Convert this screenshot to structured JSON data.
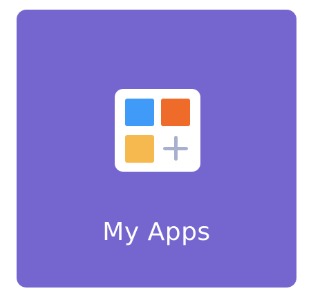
{
  "tile": {
    "label": "My Apps",
    "background_color": "#7566cf",
    "icon": "apps-grid-add-icon",
    "icon_colors": {
      "blue": "#3f9af8",
      "orange": "#ef6b2a",
      "yellow": "#f5b94f",
      "plus": "#a7b1ce"
    }
  }
}
